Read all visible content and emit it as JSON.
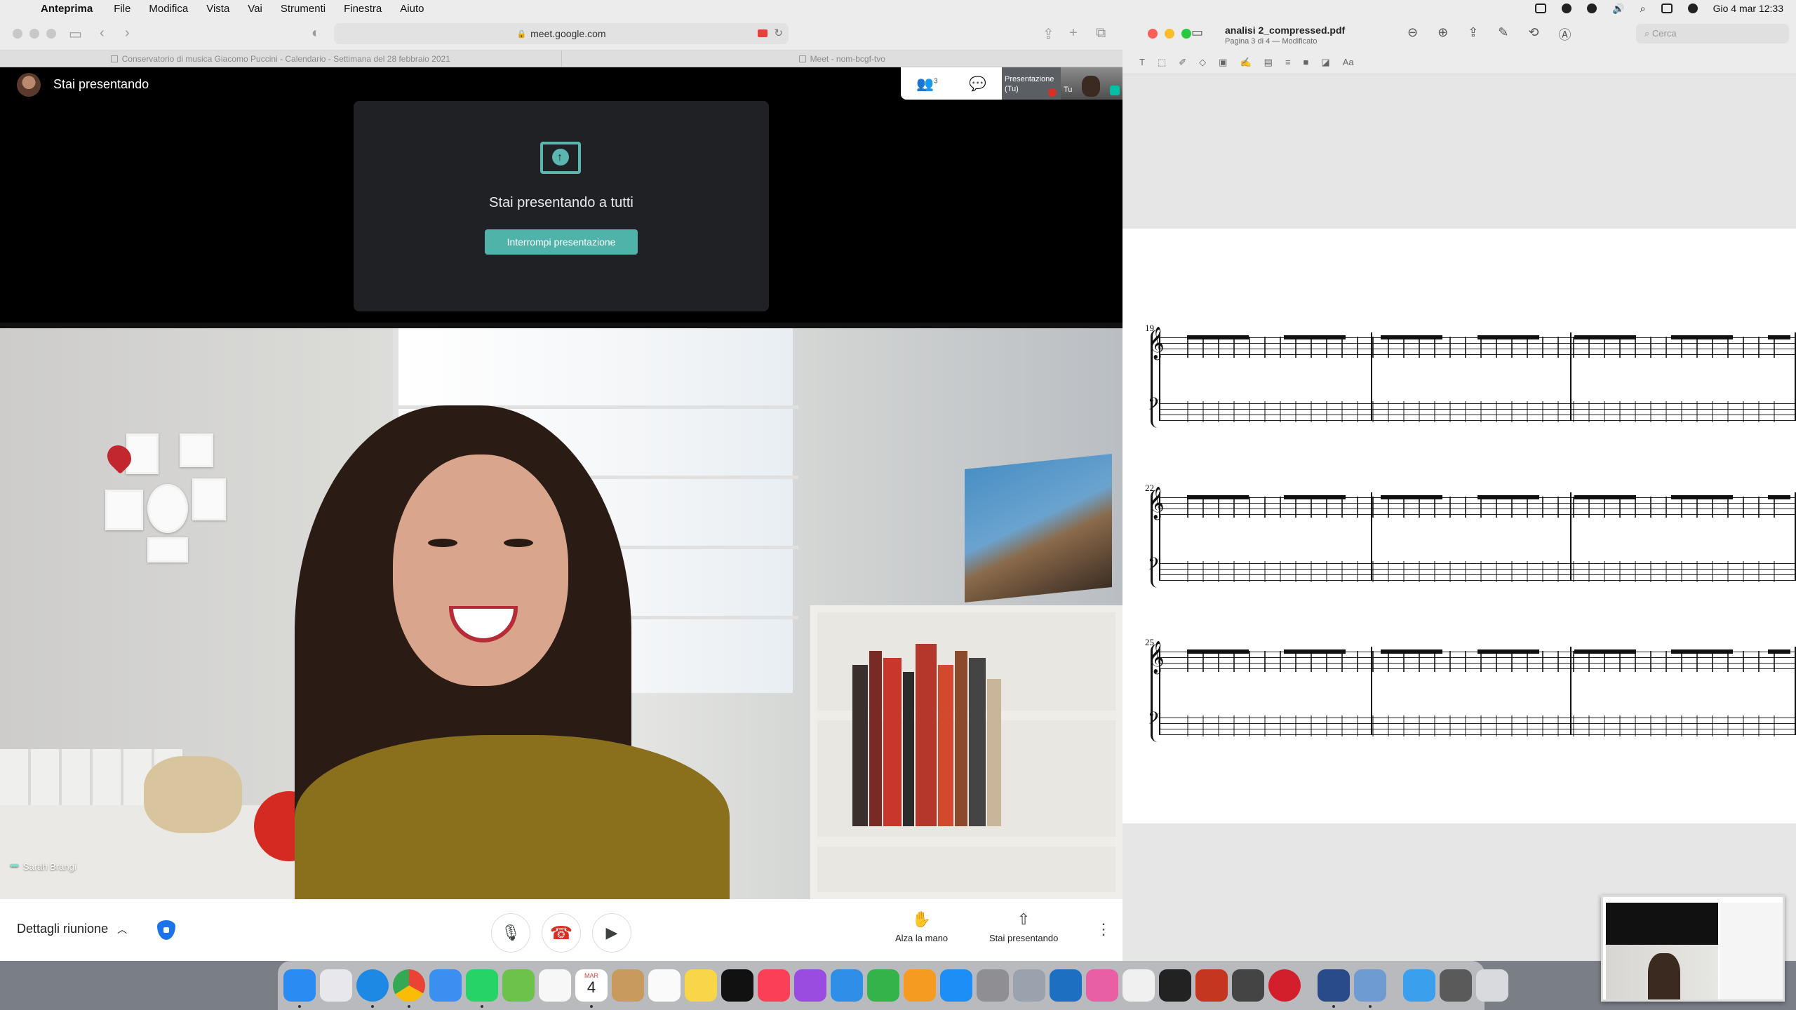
{
  "menubar": {
    "app_name": "Anteprima",
    "items": [
      "File",
      "Modifica",
      "Vista",
      "Vai",
      "Strumenti",
      "Finestra",
      "Aiuto"
    ],
    "clock": "Gio 4 mar  12:33"
  },
  "safari": {
    "url": "meet.google.com",
    "tabs": [
      {
        "title": "Conservatorio di musica Giacomo Puccini - Calendario - Settimana del 28 febbraio 2021"
      },
      {
        "title": "Meet - nom-bcgf-tvo"
      }
    ]
  },
  "meet": {
    "header_title": "Stai presentando",
    "people_count": "3",
    "present_card": {
      "message": "Stai presentando a tutti",
      "stop_button": "Interrompi presentazione"
    },
    "tiles": [
      {
        "label": "Presentazione (Tu)"
      },
      {
        "label": "Tu"
      }
    ],
    "participant_name": "Sarah Brangi",
    "bottom_bar": {
      "details_label": "Dettagli riunione",
      "raise_hand_label": "Alza la mano",
      "presenting_label": "Stai presentando"
    }
  },
  "preview": {
    "filename": "analisi 2_compressed.pdf",
    "subtitle": "Pagina 3 di 4 — Modificato",
    "search_placeholder": "Cerca",
    "measure_numbers": [
      "19",
      "22",
      "25"
    ]
  },
  "dock": {
    "calendar_month": "MAR",
    "calendar_day": "4",
    "apps": [
      {
        "name": "finder",
        "color": "#2a8bf2"
      },
      {
        "name": "launchpad",
        "color": "#e8e8ec"
      },
      {
        "name": "safari",
        "color": "#1e88e5"
      },
      {
        "name": "chrome",
        "color": "#f2f2f2"
      },
      {
        "name": "mail",
        "color": "#3b8ff0"
      },
      {
        "name": "whatsapp",
        "color": "#25d366"
      },
      {
        "name": "maps",
        "color": "#6cc24a"
      },
      {
        "name": "photos",
        "color": "#f7f7f7"
      },
      {
        "name": "calendar",
        "color": "#ffffff"
      },
      {
        "name": "contacts",
        "color": "#c89a5e"
      },
      {
        "name": "reminders",
        "color": "#fafafa"
      },
      {
        "name": "notes",
        "color": "#f8d648"
      },
      {
        "name": "tv",
        "color": "#111111"
      },
      {
        "name": "music",
        "color": "#fa3f57"
      },
      {
        "name": "podcasts",
        "color": "#9b4ce0"
      },
      {
        "name": "keynote",
        "color": "#2f8fe8"
      },
      {
        "name": "numbers",
        "color": "#34b34a"
      },
      {
        "name": "pages",
        "color": "#f59b22"
      },
      {
        "name": "app-store",
        "color": "#1c8ef5"
      },
      {
        "name": "system-preferences",
        "color": "#8e8e93"
      },
      {
        "name": "disk-utility",
        "color": "#9aa3ad"
      },
      {
        "name": "musescore",
        "color": "#1d6fc2"
      },
      {
        "name": "lotus",
        "color": "#e85fa5"
      },
      {
        "name": "textedit",
        "color": "#f0f0f0"
      },
      {
        "name": "piano",
        "color": "#222222"
      },
      {
        "name": "photo-booth",
        "color": "#c4361f"
      },
      {
        "name": "activity",
        "color": "#444444"
      },
      {
        "name": "record",
        "color": "#d21f2b"
      },
      {
        "name": "audio-mixer",
        "color": "#2a4b8a"
      },
      {
        "name": "preview",
        "color": "#6e9bd1"
      },
      {
        "name": "downloads",
        "color": "#3aa0ee"
      },
      {
        "name": "stack",
        "color": "#5a5a5a"
      },
      {
        "name": "trash",
        "color": "#d8dadd"
      }
    ]
  }
}
